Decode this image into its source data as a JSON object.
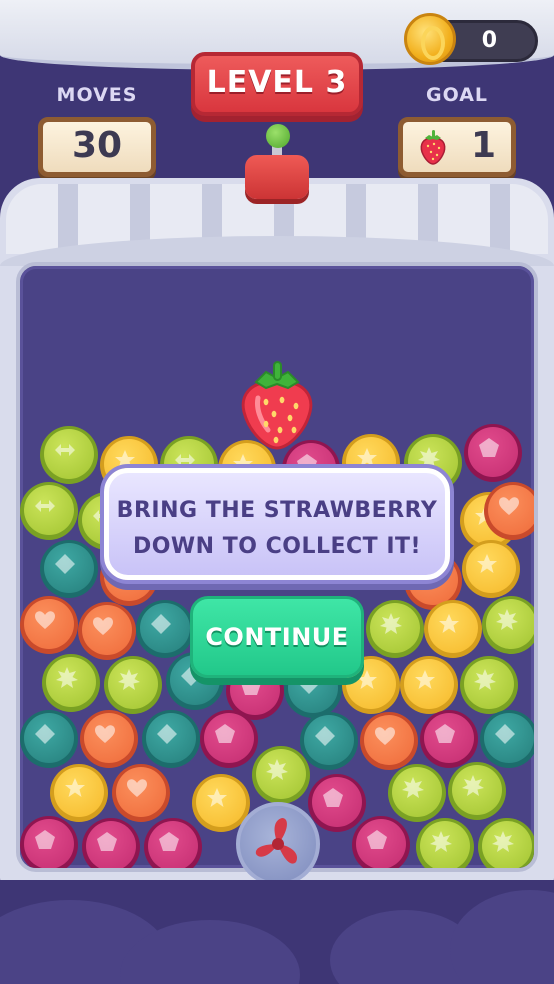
{
  "header": {
    "level_title": "LEVEL 3",
    "moves_label": "MOVES",
    "moves_value": "30",
    "goal_label": "GOAL",
    "goal_value": "1",
    "goal_item_icon": "strawberry-icon",
    "coin_count": "0",
    "coin_icon": "coin-icon"
  },
  "tutorial": {
    "line1": "BRING THE STRAWBERRY",
    "line2": "DOWN TO COLLECT IT!",
    "continue_label": "CONTINUE"
  },
  "board": {
    "target_item": "strawberry-icon",
    "booster": "fan-icon"
  },
  "colors": {
    "background": "#3e3675",
    "board": "#4a4386",
    "level_plate": "#d9363e",
    "continue_button": "#22c88a",
    "dialog_text": "#4a3f85"
  }
}
